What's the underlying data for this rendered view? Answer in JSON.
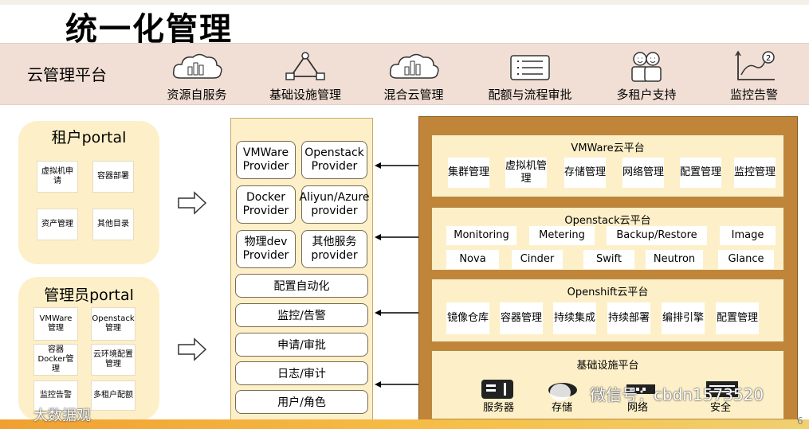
{
  "title": "统一化管理",
  "platform_band": {
    "label": "云管理平台",
    "features": [
      {
        "label": "资源自服务",
        "icon": "cloud-chart-icon"
      },
      {
        "label": "基础设施管理",
        "icon": "network-triangle-icon"
      },
      {
        "label": "混合云管理",
        "icon": "cloud-chart-icon"
      },
      {
        "label": "配额与流程审批",
        "icon": "checklist-icon"
      },
      {
        "label": "多租户支持",
        "icon": "users-icon"
      },
      {
        "label": "监控告警",
        "icon": "trend-alert-icon"
      }
    ]
  },
  "tenant_portal": {
    "title": "租户portal",
    "items": [
      "虚拟机申请",
      "容器部署",
      "资产管理",
      "其他目录"
    ]
  },
  "admin_portal": {
    "title": "管理员portal",
    "items": [
      "VMWare管理",
      "Openstack管理",
      "容器Docker管理",
      "云环境配置管理",
      "监控告警",
      "多租户配额"
    ]
  },
  "middle": {
    "providers": [
      "VMWare Provider",
      "Openstack Provider",
      "Docker Provider",
      "Aliyun/Azure provider",
      "物理dev Provider",
      "其他服务provider"
    ],
    "rows": [
      "配置自动化",
      "监控/告警",
      "申请/审批",
      "日志/审计",
      "用户/角色"
    ]
  },
  "vmware": {
    "title": "VMWare云平台",
    "chips": [
      "集群管理",
      "虚拟机管理",
      "存储管理",
      "网络管理",
      "配置管理",
      "监控管理"
    ]
  },
  "openstack": {
    "title": "Openstack云平台",
    "row1": [
      "Monitoring",
      "Metering",
      "Backup/Restore",
      "Image"
    ],
    "row2": [
      "Nova",
      "Cinder",
      "Swift",
      "Neutron",
      "Glance"
    ]
  },
  "openshift": {
    "title": "Openshift云平台",
    "chips": [
      "镜像仓库",
      "容器管理",
      "持续集成",
      "持续部署",
      "编排引擎",
      "配置管理"
    ]
  },
  "infra": {
    "title": "基础设施平台",
    "items": [
      "服务器",
      "存储",
      "网络",
      "安全"
    ]
  },
  "watermarks": {
    "wechat": "微信号：cbdn1573520",
    "left": "大数据观",
    "page_number": "6"
  }
}
